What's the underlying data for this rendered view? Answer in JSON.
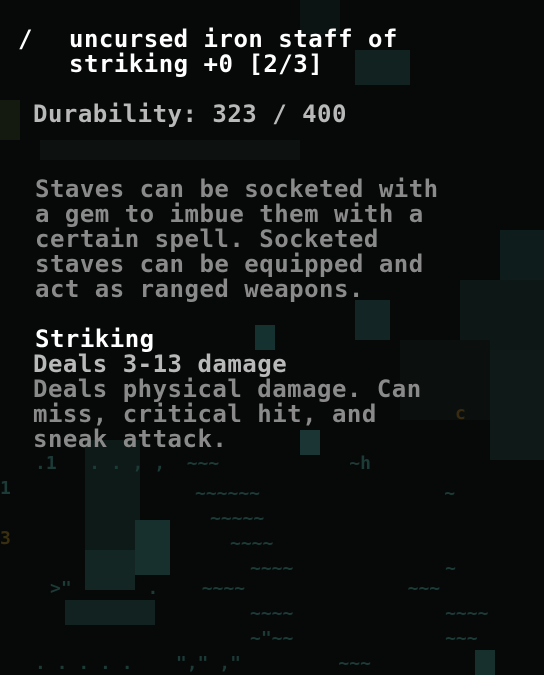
{
  "item": {
    "glyph": "/",
    "title_line1": "uncursed iron staff of",
    "title_line2": "striking +0 [2/3]",
    "durability": "Durability: 323 / 400",
    "description": [
      "Staves can be socketed with",
      "a gem to imbue them with a",
      "certain spell. Socketed",
      "staves can be equipped and",
      "act as ranged weapons."
    ],
    "spell": {
      "name": "Striking",
      "damage": "Deals 3-13 damage",
      "details": [
        "Deals physical damage. Can",
        "miss, critical hit, and",
        "sneak attack."
      ]
    }
  },
  "colors": {
    "background": "#050505",
    "title": "#ffffff",
    "subtitle": "#b9b9b9",
    "description": "#8a8a8a",
    "map_tile": "#1c3a36",
    "map_floor": "#0f1514"
  }
}
